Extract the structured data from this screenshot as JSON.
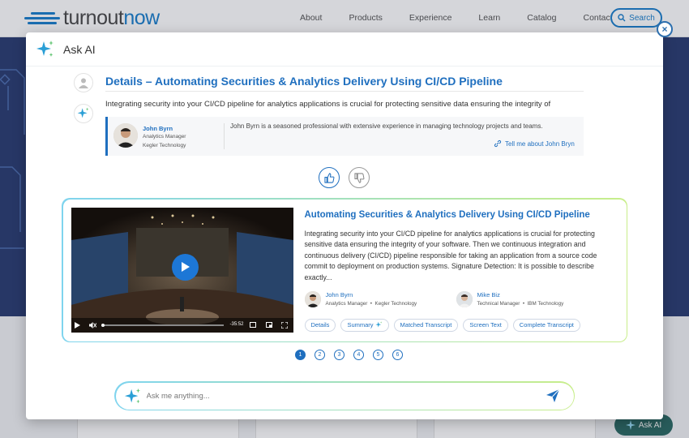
{
  "site": {
    "logo_text_a": "turnout",
    "logo_text_b": "now",
    "nav": [
      "About",
      "Products",
      "Experience",
      "Learn",
      "Catalog",
      "Contact"
    ],
    "search_label": "Search",
    "fab_label": "Ask AI"
  },
  "modal": {
    "title": "Ask AI",
    "close_symbol": "×",
    "question_title": "Details – Automating Securities & Analytics Delivery Using CI/CD Pipeline",
    "answer_text": "Integrating security into your CI/CD pipeline for analytics applications is crucial for protecting sensitive data  ensuring the integrity of",
    "expert": {
      "name": "John Byrn",
      "role": "Analytics  Manager",
      "company": "Kegler Technology",
      "bio": "John Byrn is a seasoned professional with extensive experience in managing technology projects and teams.",
      "link": "Tell me about John Bryn"
    },
    "result": {
      "title": "Automating Securities & Analytics Delivery Using CI/CD Pipeline",
      "body": "Integrating security into your CI/CD pipeline for analytics applications is crucial for protecting sensitive data  ensuring the integrity of your software. Then we continuous integration and continuous delivery (CI/CD) pipeline responsible for taking an application from a source code commit to deployment on production systems. Signature Detection: It is possible to describe exactly...",
      "video_time": "-35:52",
      "people": [
        {
          "name": "John Byrn",
          "role": "Analytics  Manager",
          "company": "Kegler Technology"
        },
        {
          "name": "Mike Biz",
          "role": "Technical  Manager",
          "company": "IBM Technology"
        }
      ],
      "tags": [
        "Details",
        "Summary",
        "Matched Transcript",
        "Screen Text",
        "Complete Transcript"
      ]
    },
    "pages": [
      "1",
      "2",
      "3",
      "4",
      "5",
      "6"
    ],
    "active_page": "1",
    "ask_placeholder": "Ask me anything..."
  },
  "colors": {
    "brand_blue": "#1f6fbf",
    "hero_navy": "#2b3d72",
    "gradient_start": "#7fd4ee",
    "gradient_end": "#c8ee8a"
  }
}
